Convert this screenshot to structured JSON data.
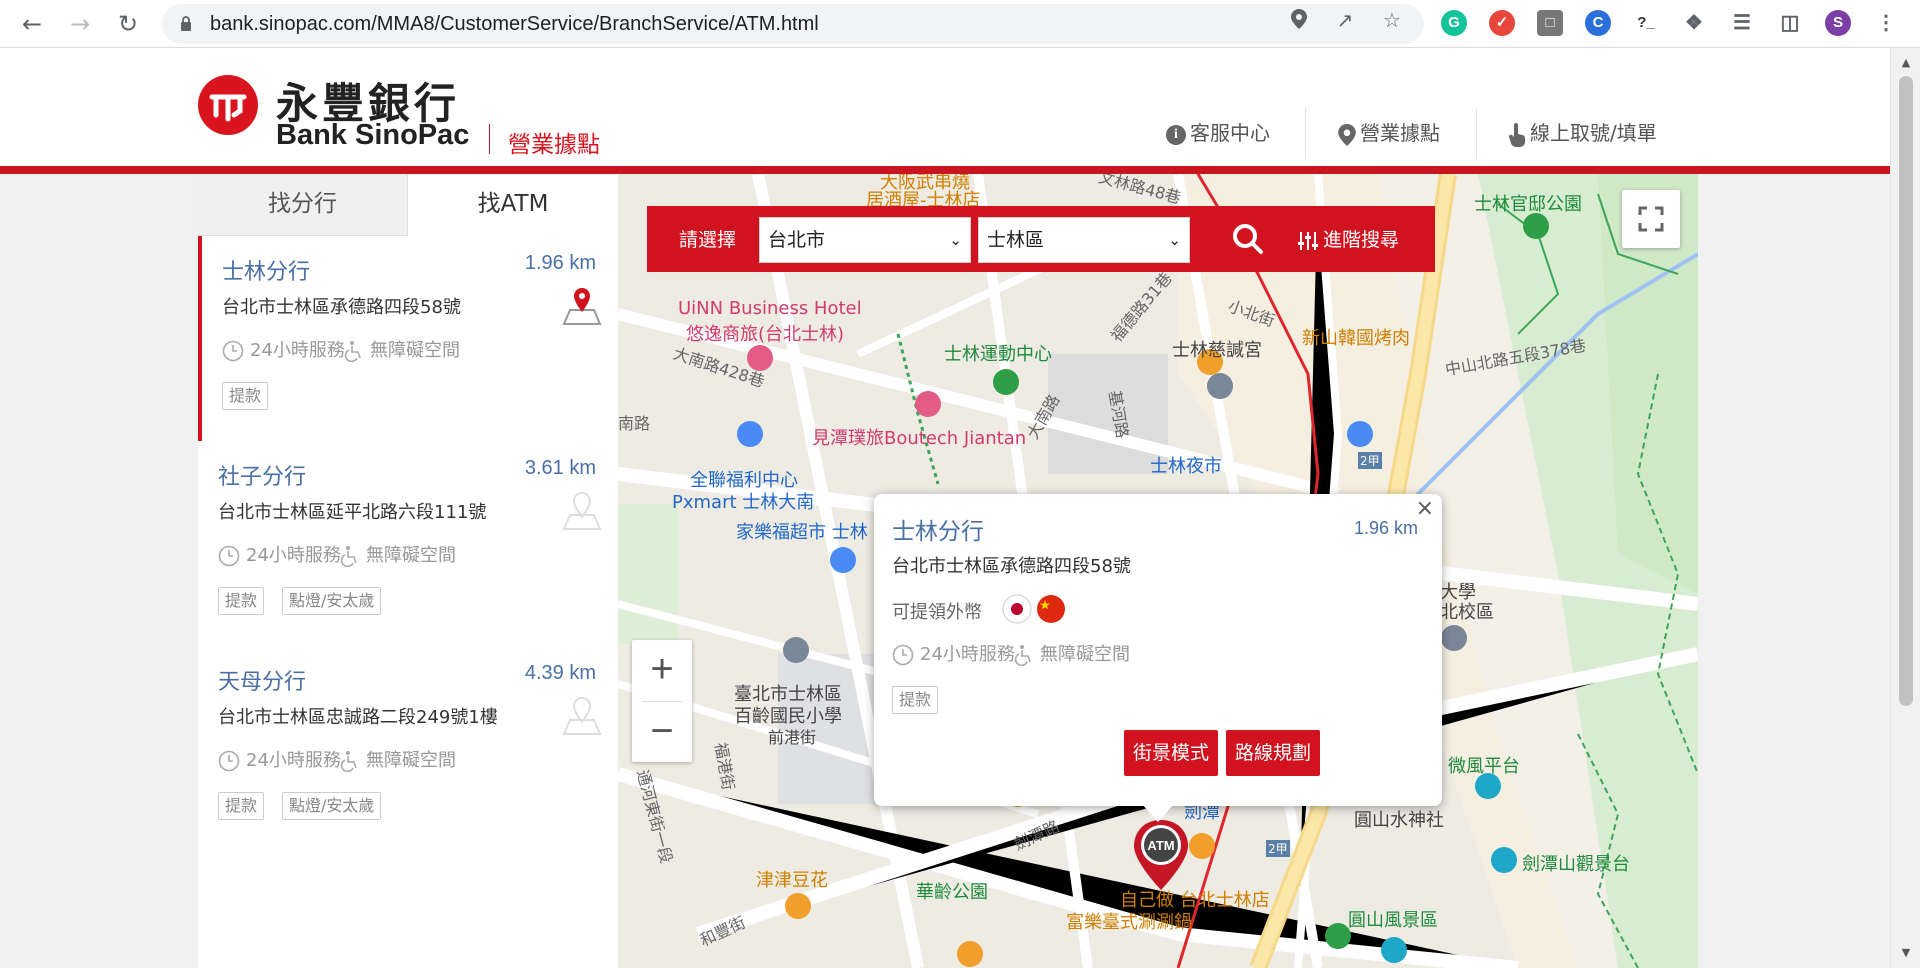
{
  "browser": {
    "url": "bank.sinopac.com/MMA8/CustomerService/BranchService/ATM.html",
    "profile_initial": "S",
    "colors": {
      "profile_bg": "#7b3fa5",
      "grammarly": "#15c39a"
    }
  },
  "header": {
    "brand_cn": "永豐銀行",
    "brand_en": "Bank SinoPac",
    "section": "營業據點",
    "nav": [
      {
        "label": "客服中心",
        "icon": "info-icon"
      },
      {
        "label": "營業據點",
        "icon": "location-pin-icon"
      },
      {
        "label": "線上取號/填單",
        "icon": "hand-pointer-icon"
      }
    ],
    "accent": "#d0131f"
  },
  "panel": {
    "tabs": [
      {
        "label": "找分行",
        "active": false
      },
      {
        "label": "找ATM",
        "active": true
      }
    ],
    "items": [
      {
        "name": "士林分行",
        "distance": "1.96 km",
        "address": "台北市士林區承德路四段58號",
        "hours": "24小時服務",
        "accessible": "無障礙空間",
        "tags": [
          "提款"
        ],
        "selected": true
      },
      {
        "name": "社子分行",
        "distance": "3.61 km",
        "address": "台北市士林區延平北路六段111號",
        "hours": "24小時服務",
        "accessible": "無障礙空間",
        "tags": [
          "提款",
          "點燈/安太歲"
        ],
        "selected": false
      },
      {
        "name": "天母分行",
        "distance": "4.39 km",
        "address": "台北市士林區忠誠路二段249號1樓",
        "hours": "24小時服務",
        "accessible": "無障礙空間",
        "tags": [
          "提款",
          "點燈/安太歲"
        ],
        "selected": false
      }
    ]
  },
  "search": {
    "label": "請選擇",
    "city": "台北市",
    "district": "士林區",
    "advanced": "進階搜尋"
  },
  "infowindow": {
    "title": "士林分行",
    "distance": "1.96 km",
    "address": "台北市士林區承德路四段58號",
    "fx_label": "可提領外幣",
    "currencies": [
      "JPY",
      "CNY"
    ],
    "hours": "24小時服務",
    "accessible": "無障礙空間",
    "tag": "提款",
    "street_view": "街景模式",
    "route": "路線規劃"
  },
  "map": {
    "atm_marker": "ATM",
    "zoom_in": "+",
    "zoom_out": "−",
    "labels": [
      {
        "text": "居酒屋-士林店",
        "cls": "lbl-orange"
      },
      {
        "text": "大阪武串燒",
        "cls": "lbl-orange"
      },
      {
        "text": "UiNN Business Hotel",
        "cls": "lbl-pink"
      },
      {
        "text": "悠逸商旅(台北士林)",
        "cls": "lbl-pink"
      },
      {
        "text": "士林運動中心",
        "cls": "lbl-green"
      },
      {
        "text": "士林慈諴宮",
        "cls": "lbl-dark"
      },
      {
        "text": "新山韓國烤肉",
        "cls": "lbl-orange"
      },
      {
        "text": "士林官邸公園",
        "cls": "lbl-green"
      },
      {
        "text": "見潭璞旅Boutech Jiantan",
        "cls": "lbl-pink"
      },
      {
        "text": "全聯福利中心",
        "cls": "lbl-blue"
      },
      {
        "text": "Pxmart 士林大南",
        "cls": "lbl-blue"
      },
      {
        "text": "家樂福超市 士林",
        "cls": "lbl-blue"
      },
      {
        "text": "士林夜市",
        "cls": "lbl-blue"
      },
      {
        "text": "臺北市士林區",
        "cls": "lbl-dark"
      },
      {
        "text": "百齡國民小學",
        "cls": "lbl-dark"
      },
      {
        "text": "前港街",
        "cls": "lbl-dark"
      },
      {
        "text": "津津豆花",
        "cls": "lbl-orange"
      },
      {
        "text": "華齡公園",
        "cls": "lbl-green"
      },
      {
        "text": "自己做 台北士林店",
        "cls": "lbl-orange"
      },
      {
        "text": "富樂臺式涮涮鍋",
        "cls": "lbl-orange"
      },
      {
        "text": "微風平台",
        "cls": "lbl-green"
      },
      {
        "text": "圓山水神社",
        "cls": "lbl-dark"
      },
      {
        "text": "劍潭山觀景台",
        "cls": "lbl-green"
      },
      {
        "text": "圓山風景區",
        "cls": "lbl-green"
      },
      {
        "text": "大學",
        "cls": "lbl-dark"
      },
      {
        "text": "北校區",
        "cls": "lbl-dark"
      },
      {
        "text": "大南路428巷",
        "cls": "lbl-road"
      },
      {
        "text": "大南路",
        "cls": "lbl-road"
      },
      {
        "text": "福德路31巷",
        "cls": "lbl-road"
      },
      {
        "text": "小北街",
        "cls": "lbl-road"
      },
      {
        "text": "中山北路五段378巷",
        "cls": "lbl-road"
      },
      {
        "text": "劍潭路",
        "cls": "lbl-road"
      },
      {
        "text": "和豐街",
        "cls": "lbl-road"
      },
      {
        "text": "通河東街一段",
        "cls": "lbl-road"
      },
      {
        "text": "福港街",
        "cls": "lbl-road"
      },
      {
        "text": "基河路",
        "cls": "lbl-road"
      },
      {
        "text": "文林路48巷",
        "cls": "lbl-road"
      },
      {
        "text": "南路",
        "cls": "lbl-road"
      },
      {
        "text": "劍潭",
        "cls": "lbl-blue"
      },
      {
        "text": "2甲",
        "cls": "lbl-road"
      },
      {
        "text": "2甲",
        "cls": "lbl-road"
      }
    ]
  }
}
